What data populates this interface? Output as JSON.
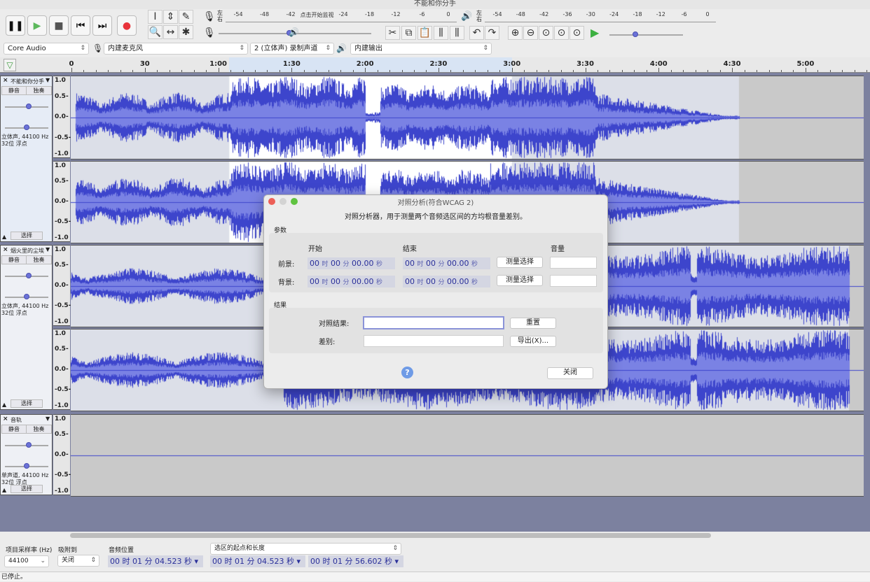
{
  "window": {
    "title": "不能和你分手"
  },
  "toolbar": {
    "transport": [
      {
        "name": "pause",
        "glyph": "❚❚"
      },
      {
        "name": "play",
        "glyph": "▶"
      },
      {
        "name": "stop",
        "glyph": "■"
      },
      {
        "name": "skip-start",
        "glyph": "⏮"
      },
      {
        "name": "skip-end",
        "glyph": "⏭"
      },
      {
        "name": "record",
        "glyph": "●"
      }
    ],
    "tools": [
      "I",
      "⇕",
      "✎",
      "🔍",
      "↔",
      "✱"
    ],
    "record_meter": {
      "l": "左",
      "r": "右",
      "ticks": [
        "-54",
        "-48",
        "-42",
        "点击开始监视",
        "-24",
        "-18",
        "-12",
        "-6",
        "0"
      ]
    },
    "play_meter": {
      "l": "左",
      "r": "右",
      "ticks": [
        "-54",
        "-48",
        "-42",
        "-36",
        "-30",
        "-24",
        "-18",
        "-12",
        "-6",
        "0"
      ]
    },
    "record_volume": 0.48,
    "play_volume": 0.05,
    "play_speed": 0.35,
    "edit": [
      "✂",
      "⧉",
      "📋",
      "⫼",
      "⫼",
      "↶",
      "↷"
    ],
    "zoom": [
      "⊕",
      "⊖",
      "⊙",
      "⊙",
      "⊙"
    ]
  },
  "devices": {
    "host": "Core Audio",
    "input": "内建麦克风",
    "channels": "2 (立体声) 录制声道",
    "output": "内建输出"
  },
  "ruler": {
    "labels": [
      "0",
      "30",
      "1:00",
      "1:30",
      "2:00",
      "2:30",
      "3:00",
      "3:30",
      "4:00",
      "4:30",
      "5:00"
    ],
    "selection": [
      "1:04.523",
      "3:00"
    ]
  },
  "tracks": [
    {
      "name": "不能和你分手",
      "mute": "静音",
      "solo": "独奏",
      "info1": "立体声, 44100 Hz",
      "info2": "32位 浮点",
      "select": "选择",
      "gain": 0.55,
      "pan": 0.5,
      "channels": 2
    },
    {
      "name": "烟火里的尘埃",
      "mute": "静音",
      "solo": "独奏",
      "info1": "立体声, 44100 Hz",
      "info2": "32位 浮点",
      "select": "选择",
      "gain": 0.55,
      "pan": 0.5,
      "channels": 2
    },
    {
      "name": "音轨",
      "mute": "静音",
      "solo": "独奏",
      "info1": "单声道, 44100 Hz",
      "info2": "32位 浮点",
      "select": "选择",
      "gain": 0.55,
      "pan": 0.5,
      "channels": 1
    }
  ],
  "yaxis": [
    "1.0",
    "0.5-",
    "0.0-",
    "-0.5-",
    "-1.0"
  ],
  "dialog": {
    "title": "对照分析(符合WCAG 2)",
    "desc": "对照分析器，用于测量两个音频选区间的方均根音量差别。",
    "params": "参数",
    "col_start": "开始",
    "col_end": "结束",
    "col_volume": "音量",
    "fg": "前景:",
    "bg": "背景:",
    "time": {
      "h": "00",
      "hu": "时",
      "m": "00",
      "mu": "分",
      "s": "00.00",
      "su": "秒"
    },
    "measure": "测量选择",
    "results": "结果",
    "contrast": "对照结果:",
    "diff": "差别:",
    "reset": "重置",
    "export": "导出(X)...",
    "close": "关闭",
    "help": "?"
  },
  "bottombar": {
    "rate_label": "项目采样率 (Hz)",
    "rate": "44100",
    "snap_label": "吸附到",
    "snap": "关闭",
    "pos_label": "音频位置",
    "pos": "00 时 01 分 04.523 秒",
    "sel_mode": "选区的起点和长度",
    "sel_start": "00 时 01 分 04.523 秒",
    "sel_len": "00 时 01 分 56.602 秒"
  },
  "status": "已停止。",
  "colors": {
    "wave": "#3d45cc",
    "rms": "#7a82e4",
    "selection": "#ffffff",
    "background": "#7c819f"
  }
}
